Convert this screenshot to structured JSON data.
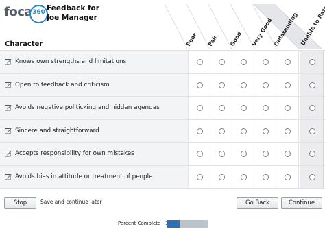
{
  "brand": {
    "word": "focal",
    "number": "360"
  },
  "title": {
    "line1": "Feedback for",
    "line2": "Joe Manager"
  },
  "section": {
    "heading": "Character"
  },
  "scale": {
    "labels": [
      "Poor",
      "Fair",
      "Good",
      "Very Good",
      "Outstanding",
      "Unable to Rate"
    ]
  },
  "questions": [
    "Knows own strengths and limitations",
    "Open to feedback and criticism",
    "Avoids negative politicking and hidden agendas",
    "Sincere and straightforward",
    "Accepts responsibility for own mistakes",
    "Avoids bias in attitude or treatment of people"
  ],
  "footer": {
    "stop_label": "Stop",
    "save_later": "Save and continue later",
    "back_label": "Go Back",
    "continue_label": "Continue"
  },
  "progress": {
    "label": "Percent Complete - 31%",
    "percent": 31
  },
  "colors": {
    "accent": "#2f6fb3",
    "logo_blue": "#2f86c6"
  }
}
